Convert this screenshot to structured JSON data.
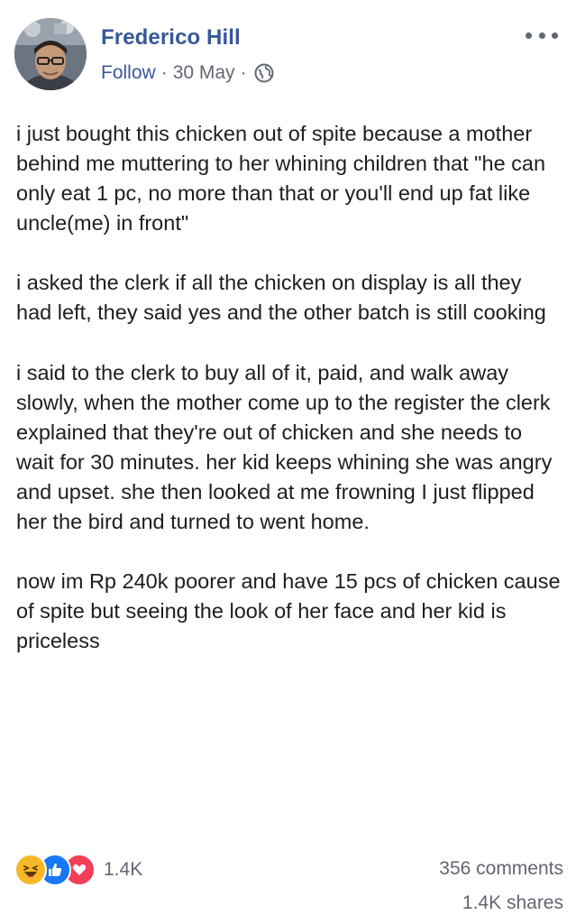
{
  "post": {
    "author": "Frederico Hill",
    "follow_label": "Follow",
    "separator": "·",
    "date": "30 May",
    "privacy_icon": "globe-icon",
    "more_icon": "more-options-icon",
    "paragraphs": [
      "i just bought this chicken out of spite because a mother behind me muttering to her whining children that \"he can only eat 1 pc, no more than that or you'll end up fat like uncle(me) in front\"",
      "i asked the clerk if all the chicken on display is all they had left, they said yes and the other batch is still cooking",
      "i said to the clerk to buy all of it, paid, and walk away slowly, when the mother come up to the register the clerk explained that they're out of chicken and she needs to wait for 30 minutes. her kid keeps whining she was angry and upset. she then looked at me frowning I just flipped her the bird and turned to went home.",
      "now im Rp 240k poorer and have 15 pcs of chicken cause of spite but seeing the look of her face and her kid is priceless"
    ]
  },
  "footer": {
    "reactions": [
      "haha-icon",
      "like-icon",
      "love-icon"
    ],
    "reaction_count": "1.4K",
    "comments": "356 comments",
    "shares": "1.4K shares"
  },
  "colors": {
    "link_blue": "#385898",
    "meta_gray": "#616770",
    "text": "#1c1e21"
  }
}
